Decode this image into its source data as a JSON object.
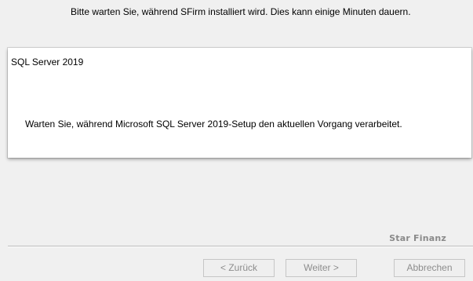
{
  "header": {
    "message": "Bitte warten Sie, während SFirm installiert wird. Dies kann einige Minuten dauern."
  },
  "dialog": {
    "title": "SQL Server 2019",
    "message": "Warten Sie, während Microsoft SQL Server 2019-Setup den aktuellen Vorgang verarbeitet."
  },
  "footer": {
    "brand": "Star Finanz"
  },
  "buttons": {
    "back_label": "< Zurück",
    "next_label": "Weiter >",
    "cancel_label": "Abbrechen",
    "disabled_text_color": "#8d8d8d"
  }
}
